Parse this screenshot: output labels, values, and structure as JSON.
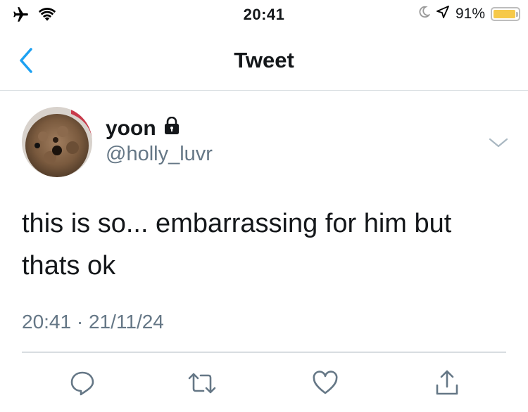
{
  "status_bar": {
    "time": "20:41",
    "battery_percent": "91%",
    "battery_level": 0.91,
    "battery_color": "#f6c94a",
    "icons": [
      "airplane-icon",
      "wifi-icon",
      "moon-icon",
      "location-icon",
      "battery-icon"
    ]
  },
  "nav": {
    "title": "Tweet",
    "back_icon": "chevron-left-icon",
    "accent_color": "#1da1f2"
  },
  "tweet": {
    "author_name": "yoon",
    "handle": "@holly_luvr",
    "protected_icon": "lock-icon",
    "text": "this is so... embarrassing for him but thats ok",
    "timestamp": "20:41 · 21/11/24"
  },
  "actions": [
    "reply-icon",
    "retweet-icon",
    "like-icon",
    "share-icon"
  ]
}
